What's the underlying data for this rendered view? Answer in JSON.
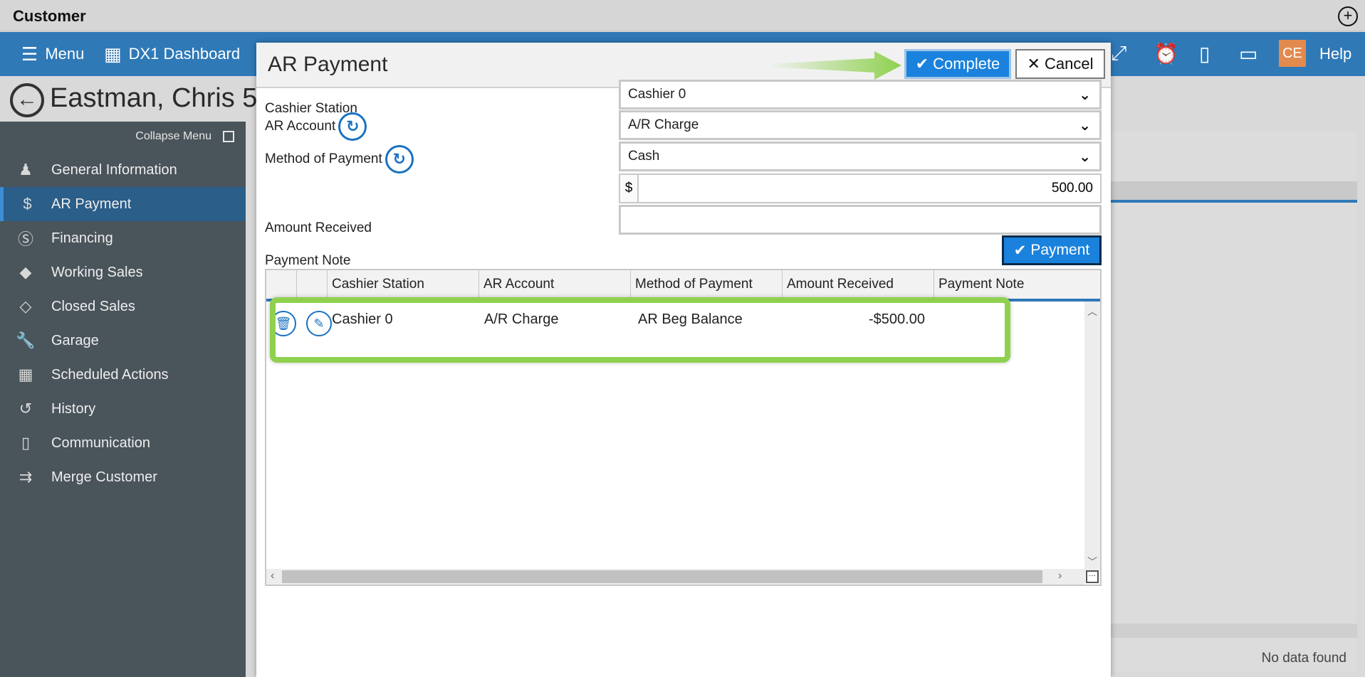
{
  "app": {
    "title": "Customer",
    "plus_icon": "plus-circle-icon"
  },
  "navbar": {
    "menu_label": "Menu",
    "dashboard_label": "DX1 Dashboard",
    "user_initials": "CE",
    "help_label": "Help",
    "icons": [
      "expand-icon",
      "alarm-clock-icon",
      "phone-icon",
      "chat-icon"
    ]
  },
  "customer": {
    "name": "Eastman, Chris 5"
  },
  "sidebar": {
    "collapse_label": "Collapse Menu",
    "items": [
      {
        "label": "General Information",
        "icon": "person-icon"
      },
      {
        "label": "AR Payment",
        "icon": "dollar-ar-icon"
      },
      {
        "label": "Financing",
        "icon": "dollar-circle-icon"
      },
      {
        "label": "Working Sales",
        "icon": "tag-icon"
      },
      {
        "label": "Closed Sales",
        "icon": "tags-icon"
      },
      {
        "label": "Garage",
        "icon": "wrench-icon"
      },
      {
        "label": "Scheduled Actions",
        "icon": "calendar-icon"
      },
      {
        "label": "History",
        "icon": "history-icon"
      },
      {
        "label": "Communication",
        "icon": "phone-icon"
      },
      {
        "label": "Merge Customer",
        "icon": "merge-icon"
      }
    ],
    "active_index": 1
  },
  "background_panel": {
    "no_data": "No data found"
  },
  "modal": {
    "title": "AR Payment",
    "complete_label": "Complete",
    "cancel_label": "Cancel",
    "form": {
      "cashier_station_label": "Cashier Station",
      "cashier_station_value": "Cashier 0",
      "ar_account_label": "AR Account",
      "ar_account_value": "A/R Charge",
      "method_label": "Method of Payment",
      "method_value": "Cash",
      "amount_label": "Amount Received",
      "currency": "$",
      "amount_value": "500.00",
      "note_label": "Payment Note",
      "note_value": ""
    },
    "payment_button_label": "Payment",
    "grid": {
      "headers": [
        "Cashier Station",
        "AR Account",
        "Method of Payment",
        "Amount Received",
        "Payment Note"
      ],
      "rows": [
        {
          "cashier_station": "Cashier 0",
          "ar_account": "A/R Charge",
          "method": "AR Beg Balance",
          "amount": "-$500.00",
          "note": ""
        }
      ]
    }
  },
  "colors": {
    "accent": "#2f79b7",
    "button_blue": "#1a82dc",
    "highlight_green": "#8fd14f",
    "sidebar_bg": "#4a545b",
    "badge": "#e38a4e"
  }
}
